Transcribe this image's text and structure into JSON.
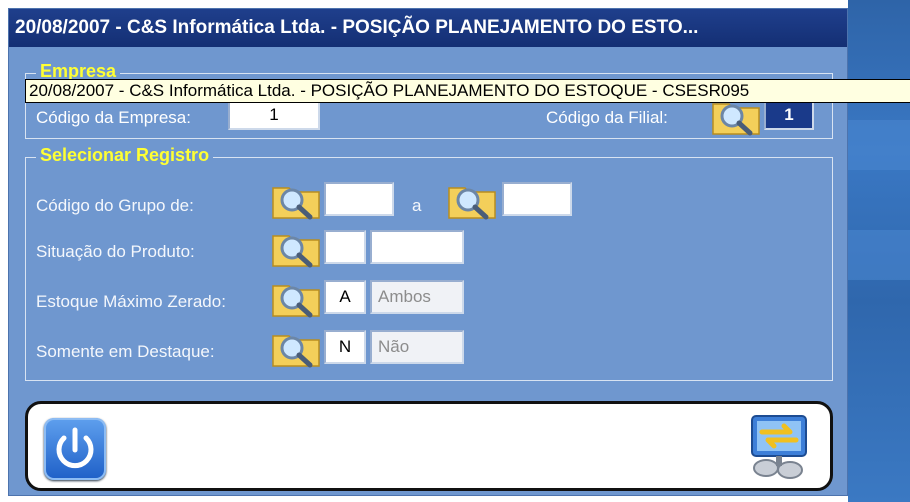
{
  "window": {
    "title": "20/08/2007  -  C&S Informática Ltda.  -  POSIÇÃO PLANEJAMENTO DO ESTO..."
  },
  "tooltip": {
    "text": "20/08/2007  -  C&S Informática Ltda.  -  POSIÇÃO PLANEJAMENTO DO ESTOQUE  -  CSESR095"
  },
  "empresa": {
    "legend": "Empresa",
    "codigo_empresa_label": "Código da Empresa:",
    "codigo_empresa_value": "1",
    "codigo_filial_label": "Código da Filial:",
    "codigo_filial_value": "1"
  },
  "selecionar": {
    "legend": "Selecionar Registro",
    "grupo_label": "Código do Grupo de:",
    "grupo_from": "",
    "grupo_sep": "a",
    "grupo_to": "",
    "situacao_label": "Situação do Produto:",
    "situacao_code": "",
    "situacao_desc": "",
    "estoque_label": "Estoque Máximo Zerado:",
    "estoque_code": "A",
    "estoque_desc": "Ambos",
    "destaque_label": "Somente em Destaque:",
    "destaque_code": "N",
    "destaque_desc": "Não"
  },
  "footer": {
    "exit_icon": "power-icon",
    "switch_icon": "switch-arrows-icon"
  },
  "colors": {
    "titlebar": "#142f74",
    "window_bg": "#6f97cf",
    "legend_text": "#ffff33",
    "tooltip_bg": "#ffffe1"
  }
}
